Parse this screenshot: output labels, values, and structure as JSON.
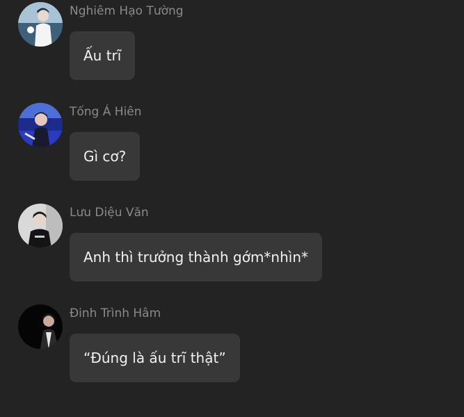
{
  "messages": [
    {
      "sender": "Nghiêm Hạo Tường",
      "text": "Ấu trĩ",
      "avatar": "avatar-photo-icon"
    },
    {
      "sender": "Tống Á Hiên",
      "text": "Gì cơ?",
      "avatar": "avatar-photo-icon"
    },
    {
      "sender": "Lưu Diệu Văn",
      "text": "Anh thì trưởng thành gớm*nhìn*",
      "avatar": "avatar-photo-icon"
    },
    {
      "sender": "Đinh Trình Hâm",
      "text": "“Đúng là ấu trĩ thật”",
      "avatar": "avatar-photo-icon"
    }
  ],
  "colors": {
    "background": "#232323",
    "bubble": "#383838",
    "sender_text": "#8a8a8a",
    "message_text": "#f2f2f2"
  }
}
